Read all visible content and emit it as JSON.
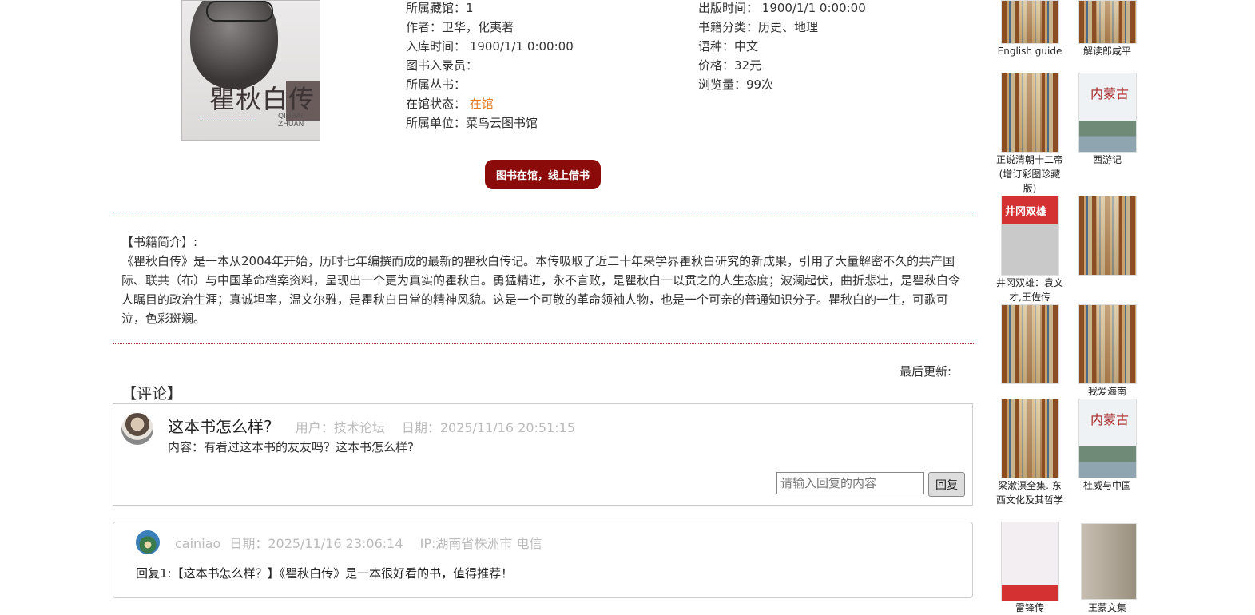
{
  "book": {
    "cover_title": "瞿秋白传",
    "cover_sub": "QIUBAI ZHUAN",
    "left_fields": [
      {
        "label": "所属藏馆：",
        "value": "1"
      },
      {
        "label": "作者：",
        "value": "卫华，化夷著"
      },
      {
        "label": "入库时间：",
        "value": " 1900/1/1 0:00:00"
      },
      {
        "label": "图书入录员：",
        "value": ""
      },
      {
        "label": "所属丛书：",
        "value": ""
      },
      {
        "label": "在馆状态：",
        "value": " 在馆"
      },
      {
        "label": "所属单位：",
        "value": "菜鸟云图书馆"
      }
    ],
    "right_fields": [
      {
        "label": "出版时间：",
        "value": " 1900/1/1 0:00:00"
      },
      {
        "label": "书籍分类：",
        "value": "历史、地理"
      },
      {
        "label": "语种：",
        "value": "中文"
      },
      {
        "label": "价格：",
        "value": "32元"
      },
      {
        "label": "浏览量：",
        "value": "99次"
      }
    ],
    "status_color": "#e07a22",
    "borrow_button": "图书在馆，线上借书",
    "intro_heading": "【书籍简介】:",
    "intro_text": "《瞿秋白传》是一本从2004年开始，历时七年编撰而成的最新的瞿秋白传记。本传吸取了近二十年来学界瞿秋白研究的新成果，引用了大量解密不久的共产国际、联共（布）与中国革命档案资料，呈现出一个更为真实的瞿秋白。勇猛精进，永不言败，是瞿秋白一以贯之的人生态度；波澜起伏，曲折悲壮，是瞿秋白令人瞩目的政治生涯；真诚坦率，温文尔雅，是瞿秋白日常的精神风貌。这是一个可敬的革命领袖人物，也是一个可亲的普通知识分子。瞿秋白的一生，可歌可泣，色彩斑斓。",
    "last_updated": "最后更新:"
  },
  "comments": {
    "heading": "【评论】",
    "question": {
      "title": "这本书怎么样?",
      "user": "用户：技术论坛",
      "date": "日期：2025/11/16 20:51:15",
      "content": "内容：有看过这本书的友友吗？这本书怎么样?",
      "reply_placeholder": "请输入回复的内容",
      "reply_button": "回复"
    },
    "reply": {
      "user": "cainiao",
      "date": "日期：2025/11/16 23:06:14",
      "ip": "IP:湖南省株洲市 电信",
      "content": "回复1:【这本书怎么样？】《瞿秋白传》是一本很好看的书，值得推荐！"
    }
  },
  "sidebar": {
    "books": [
      {
        "title": "English guide"
      },
      {
        "title": "解读郎咸平"
      },
      {
        "title": "正说清朝十二帝(增订彩图珍藏版)"
      },
      {
        "title": "西游记"
      },
      {
        "title": "井冈双雄：袁文才,王佐传"
      },
      {
        "title": ""
      },
      {
        "title": ""
      },
      {
        "title": "我爱海南"
      },
      {
        "title": "梁漱溟全集. 东西文化及其哲学"
      },
      {
        "title": "杜威与中国"
      },
      {
        "title": "雷锋传"
      },
      {
        "title": "王蒙文集"
      }
    ],
    "cover_text_jinggang": "井冈双雄",
    "cover_text_neimeng": "内蒙古"
  },
  "colors": {
    "accent": "#8b0a0a",
    "divider": "#aa3333"
  }
}
